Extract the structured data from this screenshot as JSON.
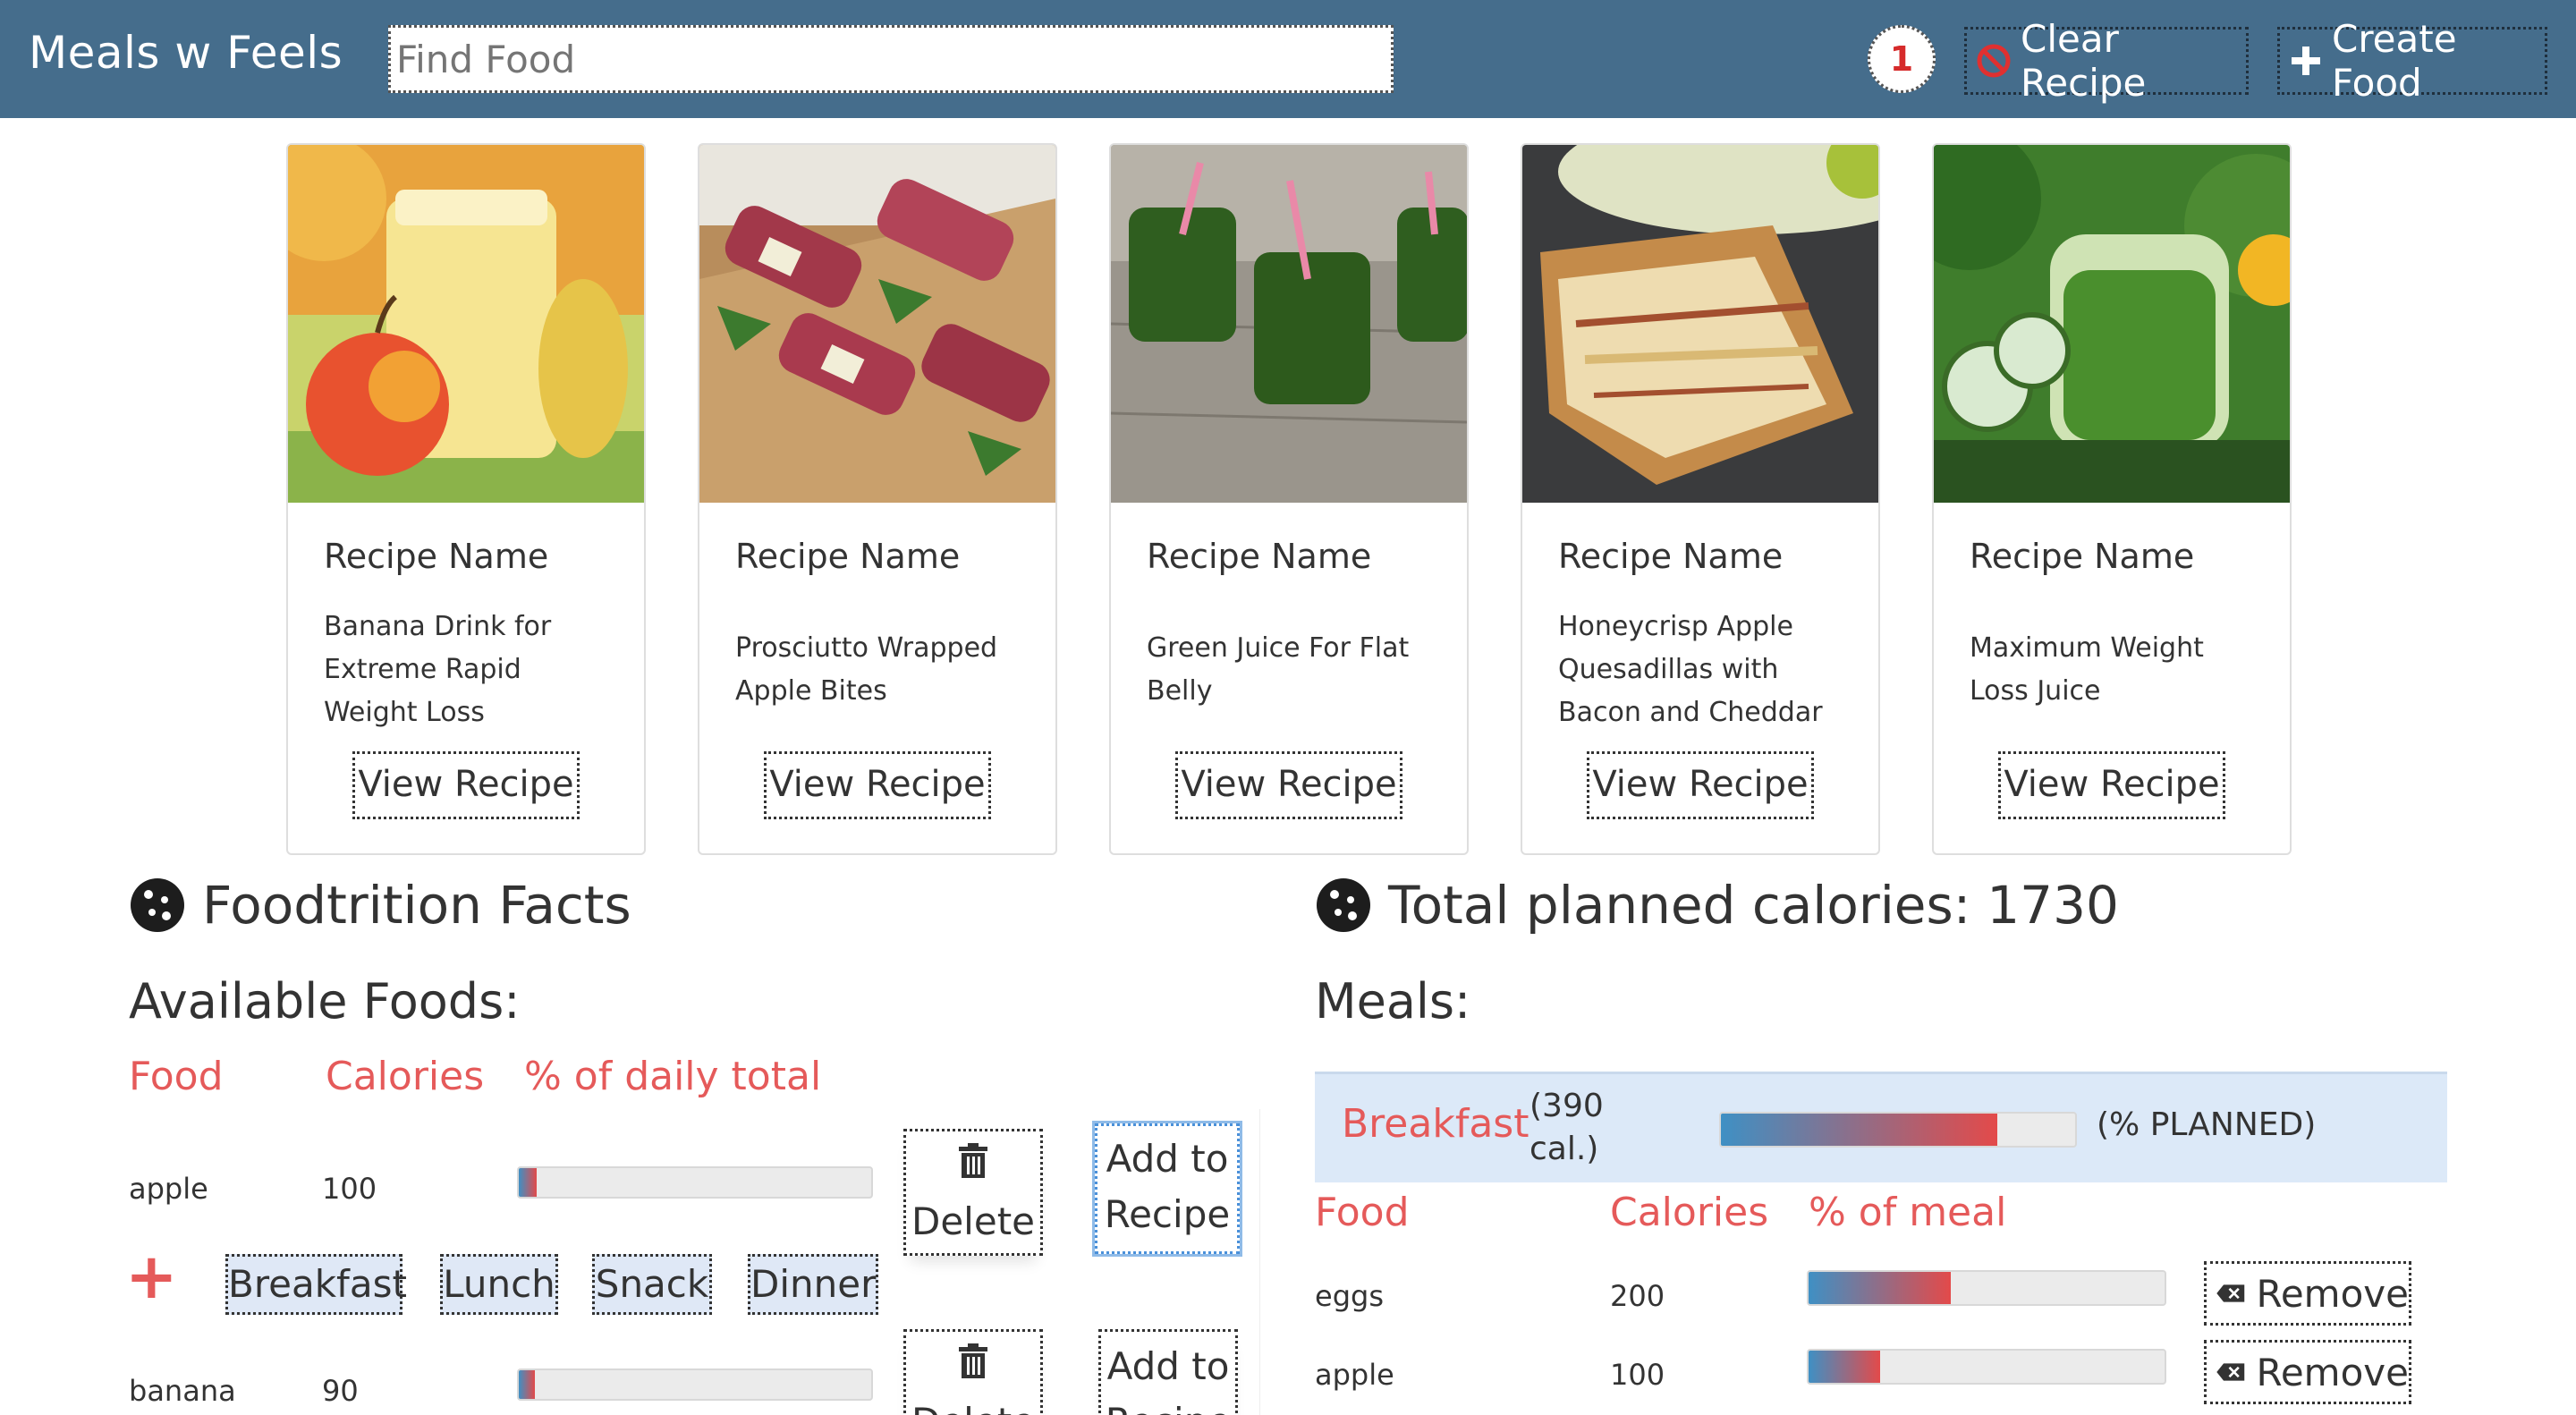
{
  "header": {
    "brand": "Meals w Feels",
    "search_placeholder": "Find Food",
    "badge_count": "1",
    "clear_label": "Clear Recipe",
    "create_label": "Create Food"
  },
  "recipes": [
    {
      "title": "Recipe Name",
      "name": "Banana Drink for Extreme Rapid Weight Loss",
      "button": "View Recipe"
    },
    {
      "title": "Recipe Name",
      "name": "Prosciutto Wrapped Apple Bites",
      "button": "View Recipe"
    },
    {
      "title": "Recipe Name",
      "name": "Green Juice For Flat Belly",
      "button": "View Recipe"
    },
    {
      "title": "Recipe Name",
      "name": "Honeycrisp Apple Quesadillas with Bacon and Cheddar",
      "button": "View Recipe"
    },
    {
      "title": "Recipe Name",
      "name": "Maximum Weight Loss Juice",
      "button": "View Recipe"
    }
  ],
  "foodtrition": {
    "heading": "Foodtrition Facts",
    "available_heading": "Available Foods:",
    "columns": [
      "Food",
      "Calories",
      "% of daily total"
    ],
    "foods": [
      {
        "name": "apple",
        "calories": "100",
        "pct": 0.05,
        "delete": "Delete",
        "add_line1": "Add to",
        "add_line2": "Recipe"
      },
      {
        "name": "banana",
        "calories": "90",
        "pct": 0.045,
        "delete": "Delete",
        "add_line1": "Add to",
        "add_line2": "Recipe"
      }
    ],
    "meal_buttons": [
      "Breakfast",
      "Lunch",
      "Snack",
      "Dinner"
    ]
  },
  "planned": {
    "heading_label": "Total planned calories:",
    "total": "1730",
    "meals_heading": "Meals:",
    "meal": {
      "name": "Breakfast",
      "cal_line1": "(390",
      "cal_line2": "cal.)",
      "planned_pct": 0.78,
      "planned_label": "(% PLANNED)"
    },
    "columns": [
      "Food",
      "Calories",
      "% of meal"
    ],
    "items": [
      {
        "name": "eggs",
        "calories": "200",
        "pct": 0.4,
        "button": "Remove"
      },
      {
        "name": "apple",
        "calories": "100",
        "pct": 0.2,
        "button": "Remove"
      }
    ]
  },
  "colors": {
    "header_bg": "#456d8c",
    "accent_red": "#e55a5a",
    "meal_bg": "#dce9f8"
  }
}
